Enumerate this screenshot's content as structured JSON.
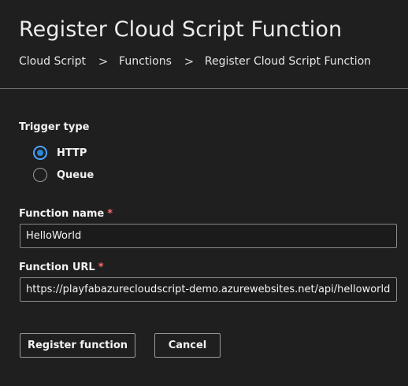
{
  "header": {
    "title": "Register Cloud Script Function",
    "breadcrumb": [
      "Cloud Script",
      "Functions",
      "Register Cloud Script Function"
    ],
    "separator": ">"
  },
  "form": {
    "trigger_type": {
      "label": "Trigger type",
      "options": [
        {
          "label": "HTTP",
          "selected": true
        },
        {
          "label": "Queue",
          "selected": false
        }
      ]
    },
    "function_name": {
      "label": "Function name",
      "required_marker": "*",
      "value": "HelloWorld"
    },
    "function_url": {
      "label": "Function URL",
      "required_marker": "*",
      "value": "https://playfabazurecloudscript-demo.azurewebsites.net/api/helloworld?code="
    }
  },
  "actions": {
    "register_label": "Register function",
    "cancel_label": "Cancel"
  },
  "colors": {
    "background": "#1f1f1f",
    "accent": "#2b88d8",
    "required": "#ff6b6b"
  }
}
